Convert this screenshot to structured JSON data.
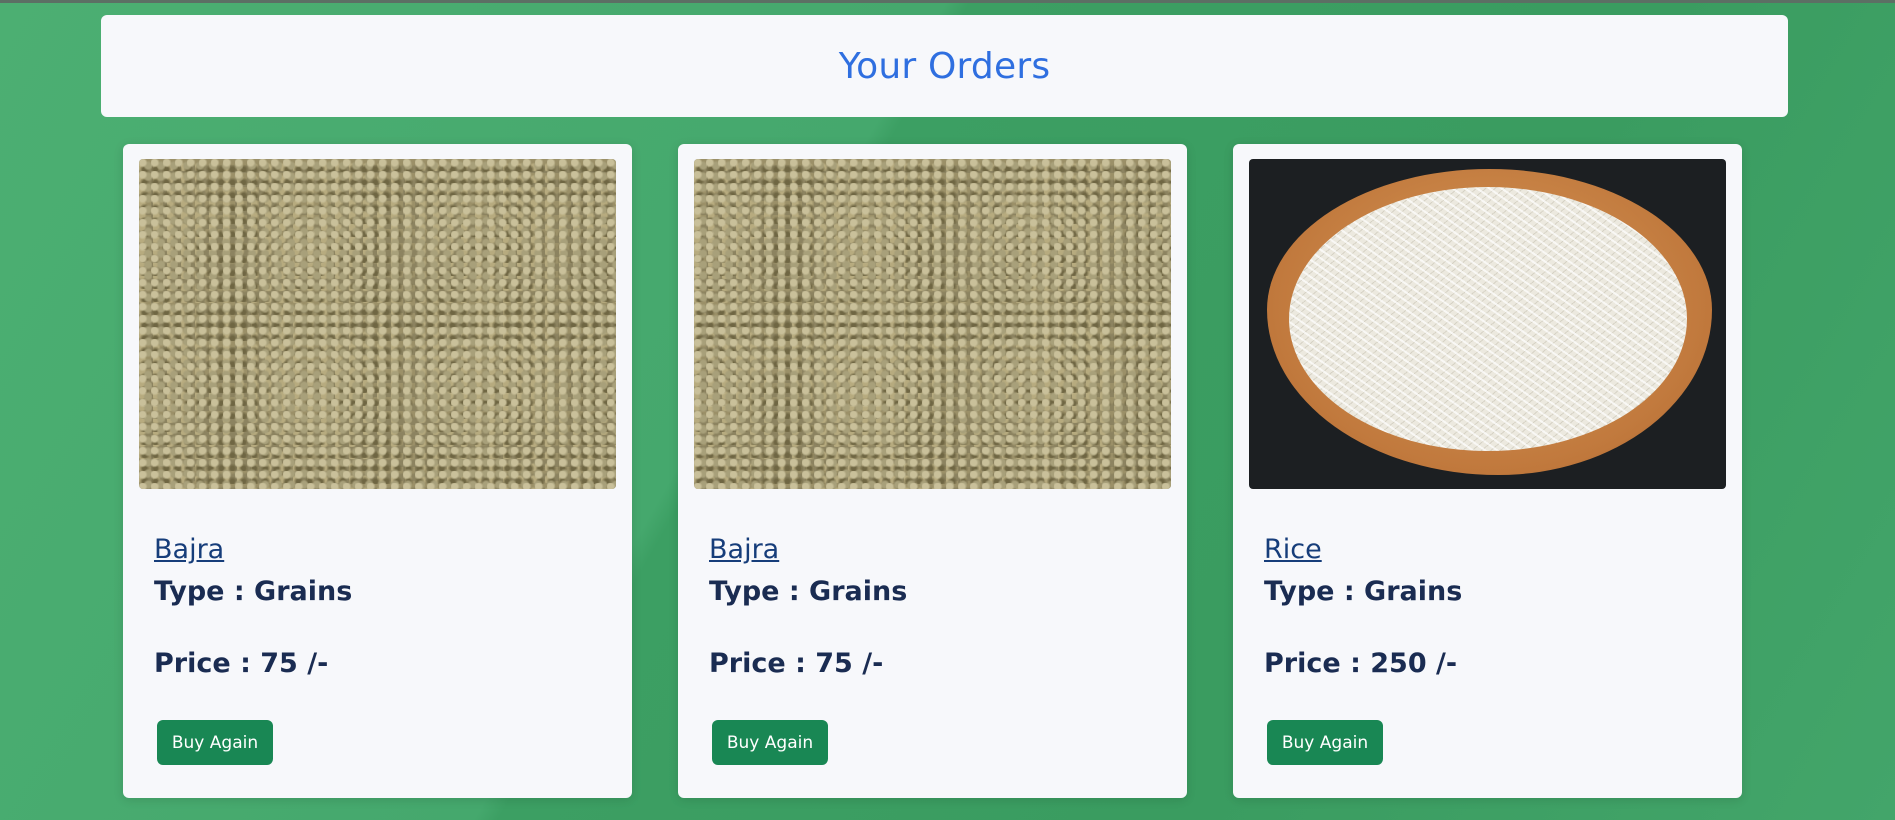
{
  "header": {
    "title": "Your Orders"
  },
  "orders": [
    {
      "name": "Bajra",
      "type": "Type : Grains",
      "price": "Price : 75 /-",
      "button": "Buy Again",
      "image": "millet"
    },
    {
      "name": "Bajra",
      "type": "Type : Grains",
      "price": "Price : 75 /-",
      "button": "Buy Again",
      "image": "millet"
    },
    {
      "name": "Rice",
      "type": "Type : Grains",
      "price": "Price : 250 /-",
      "button": "Buy Again",
      "image": "rice"
    }
  ],
  "colors": {
    "page_background": "#3fa266",
    "header_title": "#2f6fe0",
    "button": "#198754",
    "title_link": "#163d7a"
  }
}
